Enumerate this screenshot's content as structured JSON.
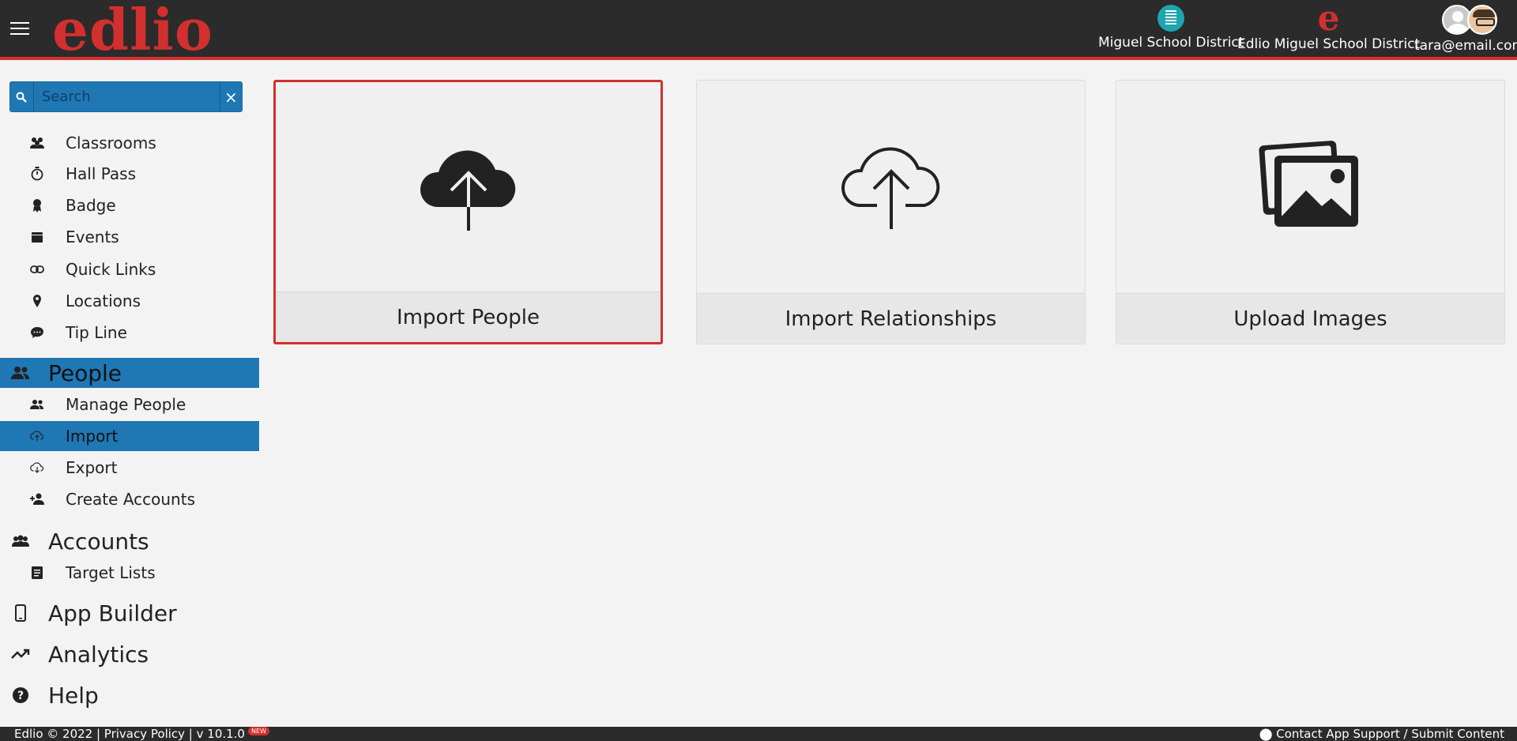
{
  "header": {
    "logo": "edlio",
    "district_label": "Miguel School District",
    "edlio_label": "Edlio Miguel School District",
    "user_email": "tara@email.com",
    "accent_color": "#d32f2f"
  },
  "sidebar": {
    "search_placeholder": "Search",
    "items": [
      {
        "label": "Classrooms",
        "icon": "users-icon"
      },
      {
        "label": "Hall Pass",
        "icon": "stopwatch-icon"
      },
      {
        "label": "Badge",
        "icon": "ribbon-icon"
      },
      {
        "label": "Events",
        "icon": "calendar-icon"
      },
      {
        "label": "Quick Links",
        "icon": "link-icon"
      },
      {
        "label": "Locations",
        "icon": "map-pin-icon"
      },
      {
        "label": "Tip Line",
        "icon": "chat-icon"
      }
    ],
    "people_section": "People",
    "people_items": [
      {
        "label": "Manage People",
        "icon": "users-icon"
      },
      {
        "label": "Import",
        "icon": "cloud-upload-icon",
        "active": true
      },
      {
        "label": "Export",
        "icon": "cloud-download-icon"
      },
      {
        "label": "Create Accounts",
        "icon": "user-plus-icon"
      }
    ],
    "accounts_section": "Accounts",
    "accounts_items": [
      {
        "label": "Target Lists",
        "icon": "list-icon"
      }
    ],
    "app_builder": "App Builder",
    "analytics": "Analytics",
    "help": "Help"
  },
  "cards": [
    {
      "label": "Import People",
      "icon": "cloud-upload-filled-icon",
      "highlighted": true
    },
    {
      "label": "Import Relationships",
      "icon": "cloud-upload-outline-icon"
    },
    {
      "label": "Upload Images",
      "icon": "images-icon"
    }
  ],
  "footer": {
    "left": "Edlio  © 2022   |   Privacy Policy   |  v 10.1.0",
    "badge": "NEW",
    "right": "Contact App Support / Submit Content"
  }
}
